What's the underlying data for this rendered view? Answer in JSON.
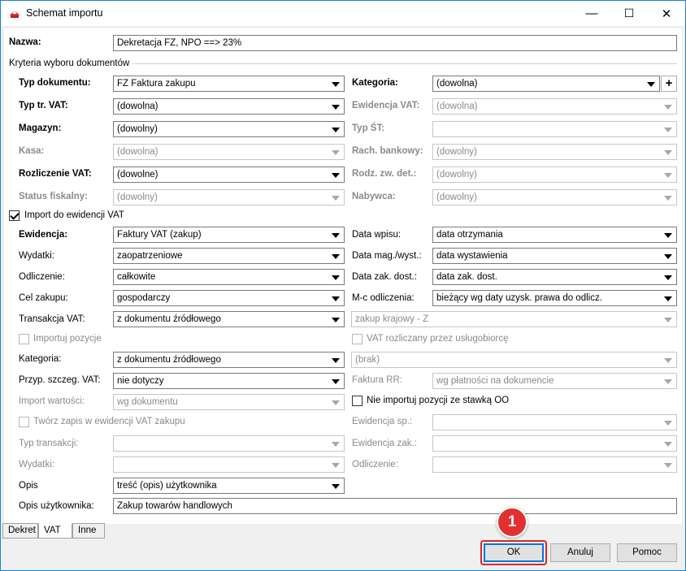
{
  "window": {
    "title": "Schemat importu",
    "minimize": "—",
    "maximize": "☐",
    "close": "✕"
  },
  "name": {
    "label": "Nazwa:",
    "value": "Dekretacja FZ, NPO ==> 23%"
  },
  "criteria": {
    "section_label": "Kryteria wyboru dokumentów",
    "typ_dokumentu": {
      "label": "Typ dokumentu:",
      "value": "FZ Faktura zakupu"
    },
    "kategoria": {
      "label": "Kategoria:",
      "value": "(dowolna)",
      "add": "+"
    },
    "typ_tr_vat": {
      "label": "Typ tr. VAT:",
      "value": "(dowolna)"
    },
    "ewidencja_vat": {
      "label": "Ewidencja VAT:",
      "value": "(dowolna)"
    },
    "magazyn": {
      "label": "Magazyn:",
      "value": "(dowolny)"
    },
    "typ_st": {
      "label": "Typ ŚT:",
      "value": ""
    },
    "kasa": {
      "label": "Kasa:",
      "value": "(dowolna)"
    },
    "rach_bankowy": {
      "label": "Rach. bankowy:",
      "value": "(dowolny)"
    },
    "rozliczenie_vat": {
      "label": "Rozliczenie VAT:",
      "value": "(dowolne)"
    },
    "rodz_zw_det": {
      "label": "Rodz. zw. det.:",
      "value": "(dowolny)"
    },
    "status_fiskalny": {
      "label": "Status fiskalny:",
      "value": "(dowolny)"
    },
    "nabywca": {
      "label": "Nabywca:",
      "value": "(dowolny)"
    }
  },
  "vat": {
    "import_label": "Import do ewidencji VAT",
    "ewidencja": {
      "label": "Ewidencja:",
      "value": "Faktury VAT (zakup)"
    },
    "data_wpisu": {
      "label": "Data wpisu:",
      "value": "data otrzymania"
    },
    "wydatki": {
      "label": "Wydatki:",
      "value": "zaopatrzeniowe"
    },
    "data_mag": {
      "label": "Data mag./wyst.:",
      "value": "data wystawienia"
    },
    "odliczenie": {
      "label": "Odliczenie:",
      "value": "całkowite"
    },
    "data_zak": {
      "label": "Data zak. dost.:",
      "value": "data zak. dost."
    },
    "cel_zakupu": {
      "label": "Cel zakupu:",
      "value": "gospodarczy"
    },
    "mc_odliczenia": {
      "label": "M-c odliczenia:",
      "value": "bieżący wg daty uzysk. prawa do odlicz."
    },
    "transakcja_vat": {
      "label": "Transakcja VAT:",
      "value": "z dokumentu źródłowego"
    },
    "zakup_krajowy": {
      "value": "zakup krajowy - Z"
    },
    "importuj_pozycje": "Importuj pozycje",
    "vat_uslugobiorca": "VAT rozliczany przez usługobiorcę",
    "kategoria": {
      "label": "Kategoria:",
      "value": "z dokumentu źródłowego"
    },
    "brak": {
      "value": "(brak)"
    },
    "przyp_szczeg": {
      "label": "Przyp. szczeg. VAT:",
      "value": "nie dotyczy"
    },
    "faktura_rr": {
      "label": "Faktura RR:",
      "value": "wg płatności na dokumencie"
    },
    "import_wartosci": {
      "label": "Import wartości:",
      "value": "wg dokumentu"
    },
    "nie_importuj_oo": "Nie importuj pozycji ze stawką OO",
    "tworz_zapis": "Twórz zapis w ewidencji VAT zakupu",
    "ewidencja_sp": {
      "label": "Ewidencja sp.:",
      "value": ""
    },
    "typ_transakcji": {
      "label": "Typ transakcji:",
      "value": ""
    },
    "ewidencja_zak": {
      "label": "Ewidencja zak.:",
      "value": ""
    },
    "wydatki2": {
      "label": "Wydatki:",
      "value": ""
    },
    "odliczenie2": {
      "label": "Odliczenie:",
      "value": ""
    },
    "opis": {
      "label": "Opis",
      "value": "treść (opis) użytkownika"
    },
    "opis_uzytkownika": {
      "label": "Opis użytkownika:",
      "value": "Zakup towarów handlowych"
    }
  },
  "tabs": [
    {
      "label": "Dekret"
    },
    {
      "label": "VAT"
    },
    {
      "label": "Inne"
    }
  ],
  "buttons": {
    "ok": "OK",
    "cancel": "Anuluj",
    "help": "Pomoc"
  },
  "annotation": {
    "number": "1"
  },
  "colors": {
    "accent": "#0078d7",
    "annotation": "#e23030"
  }
}
